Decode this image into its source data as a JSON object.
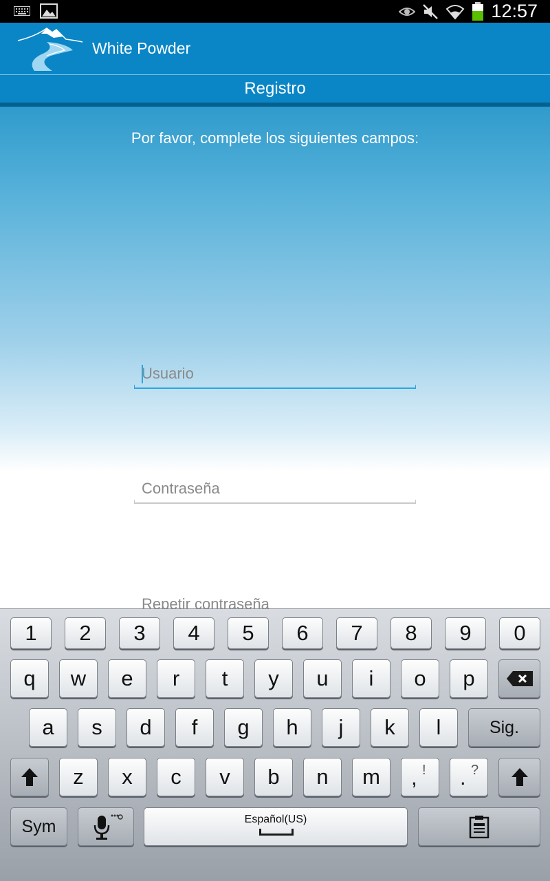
{
  "status_bar": {
    "time": "12:57",
    "icons": [
      "keyboard-icon",
      "image-icon",
      "eye-icon",
      "mute-icon",
      "wifi-icon",
      "battery-icon"
    ],
    "battery_color": "#58c000"
  },
  "app": {
    "title": "White Powder",
    "brand_color": "#0a86c6"
  },
  "page": {
    "title": "Registro",
    "instructions": "Por favor, complete los siguientes campos:"
  },
  "form": {
    "username_placeholder": "Usuario",
    "password_placeholder": "Contraseña",
    "repeat_password_placeholder": "Repetir contraseña"
  },
  "keyboard": {
    "row1": [
      "1",
      "2",
      "3",
      "4",
      "5",
      "6",
      "7",
      "8",
      "9",
      "0"
    ],
    "row2": [
      "q",
      "w",
      "e",
      "r",
      "t",
      "y",
      "u",
      "i",
      "o",
      "p"
    ],
    "row3": [
      "a",
      "s",
      "d",
      "f",
      "g",
      "h",
      "j",
      "k",
      "l"
    ],
    "row4": [
      "z",
      "x",
      "c",
      "v",
      "b",
      "n",
      "m"
    ],
    "comma_key": ",",
    "comma_alt": "!",
    "period_key": ".",
    "period_alt": "?",
    "next_label": "Sig.",
    "sym_label": "Sym",
    "space_label": "Español(US)",
    "icons": [
      "backspace-icon",
      "shift-icon",
      "microphone-icon",
      "clipboard-icon"
    ]
  }
}
